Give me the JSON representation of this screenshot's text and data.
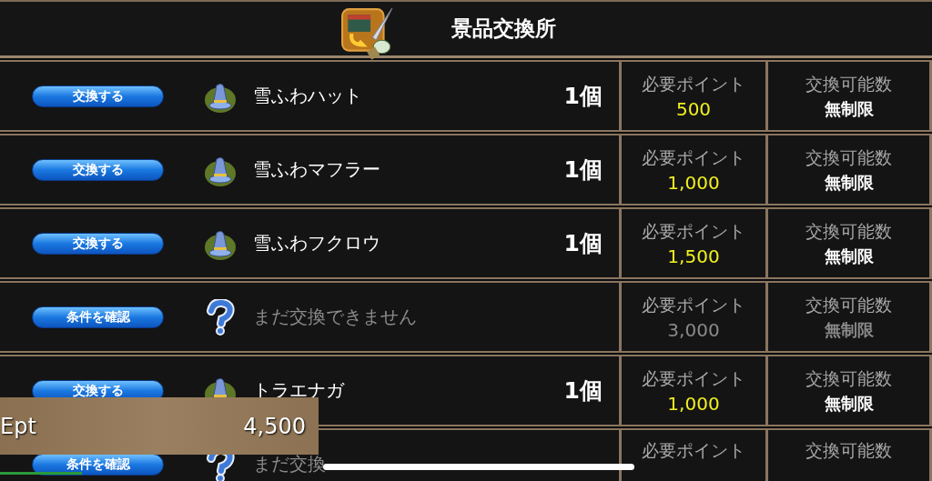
{
  "header": {
    "title": "景品交換所"
  },
  "rows": [
    {
      "available": true,
      "button": "交換する",
      "name": "雪ふわハット",
      "quantity": "1個",
      "points_label": "必要ポイント",
      "points": "500",
      "count_label": "交換可能数",
      "count": "無制限"
    },
    {
      "available": true,
      "button": "交換する",
      "name": "雪ふわマフラー",
      "quantity": "1個",
      "points_label": "必要ポイント",
      "points": "1,000",
      "count_label": "交換可能数",
      "count": "無制限"
    },
    {
      "available": true,
      "button": "交換する",
      "name": "雪ふわフクロウ",
      "quantity": "1個",
      "points_label": "必要ポイント",
      "points": "1,500",
      "count_label": "交換可能数",
      "count": "無制限"
    },
    {
      "available": false,
      "button": "条件を確認",
      "name": "まだ交換できません",
      "points_label": "必要ポイント",
      "points": "3,000",
      "count_label": "交換可能数",
      "count": "無制限"
    },
    {
      "available": true,
      "button": "交換する",
      "name": "トラエナガ",
      "quantity": "1個",
      "points_label": "必要ポイント",
      "points": "1,000",
      "count_label": "交換可能数",
      "count": "無制限"
    },
    {
      "available": false,
      "button": "条件を確認",
      "name": "まだ交換",
      "points_label": "必要ポイント",
      "count_label": "交換可能数"
    }
  ],
  "points_panel": {
    "label": "Ept",
    "value": "4,500"
  }
}
